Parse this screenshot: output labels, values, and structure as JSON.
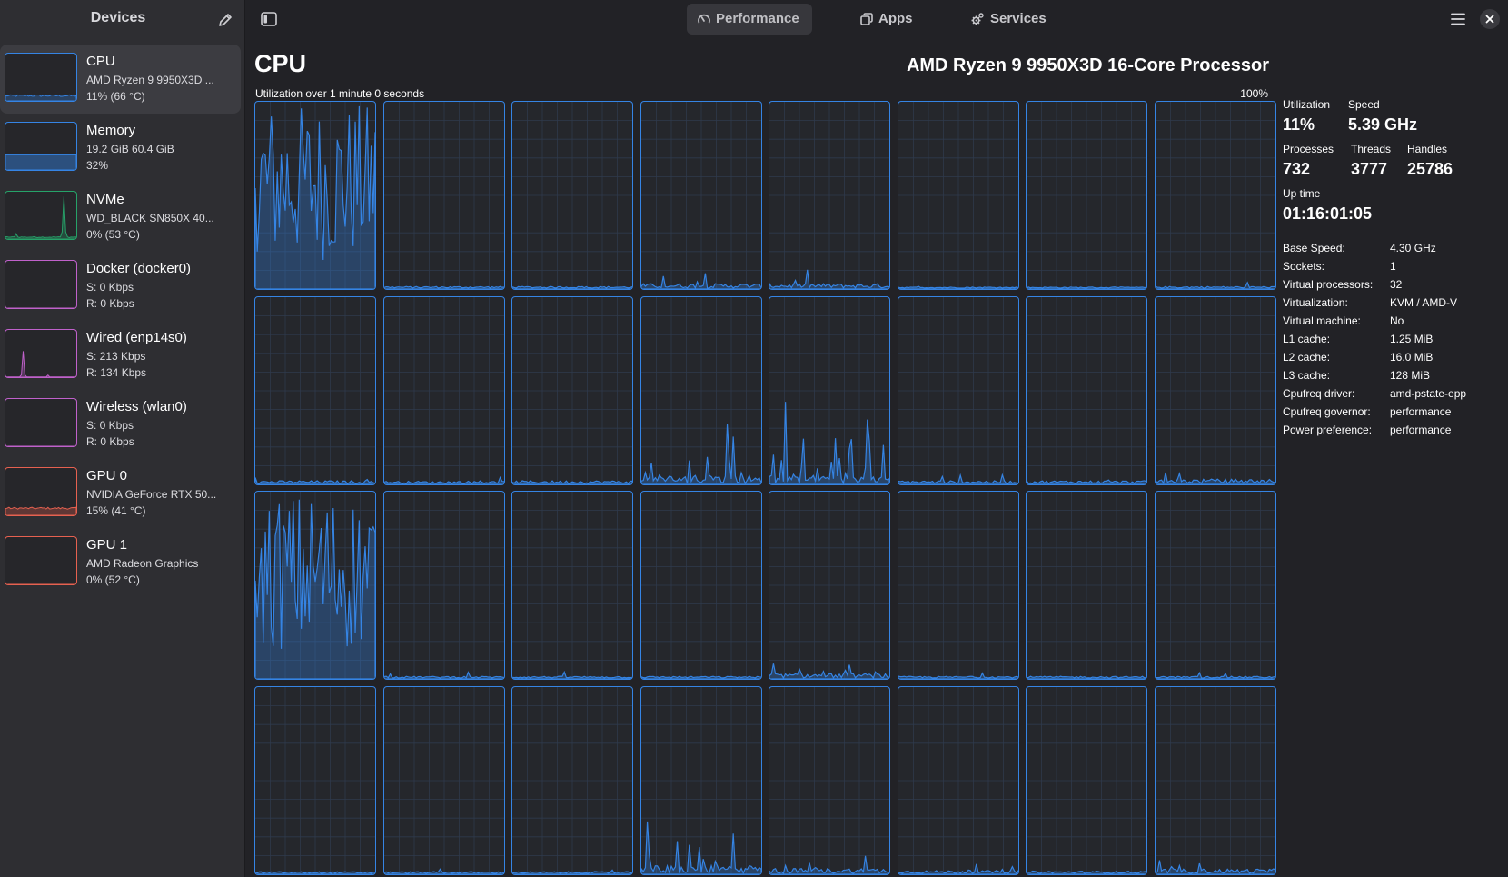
{
  "sidebar": {
    "title": "Devices",
    "edit_icon": "pencil-icon",
    "devices": [
      {
        "name": "CPU",
        "line1": "AMD Ryzen 9 9950X3D ...",
        "line2": "11% (66 °C)",
        "color": "#3584e4",
        "fill_percent": 11,
        "selected": true
      },
      {
        "name": "Memory",
        "line1": "19.2 GiB 60.4 GiB",
        "line2": "32%",
        "color": "#3584e4",
        "fill_percent": 32
      },
      {
        "name": "NVMe",
        "line1": "WD_BLACK SN850X 40...",
        "line2": "0% (53 °C)",
        "color": "#26a269"
      },
      {
        "name": "Docker (docker0)",
        "line1": "S: 0 Kbps",
        "line2": "R: 0 Kbps",
        "color": "#c061cb"
      },
      {
        "name": "Wired (enp14s0)",
        "line1": "S: 213 Kbps",
        "line2": "R: 134 Kbps",
        "color": "#c061cb"
      },
      {
        "name": "Wireless (wlan0)",
        "line1": "S: 0 Kbps",
        "line2": "R: 0 Kbps",
        "color": "#c061cb"
      },
      {
        "name": "GPU 0",
        "line1": "NVIDIA GeForce RTX 50...",
        "line2": "15% (41 °C)",
        "color": "#e66150",
        "fill_percent": 15
      },
      {
        "name": "GPU 1",
        "line1": "AMD Radeon Graphics",
        "line2": "0% (52 °C)",
        "color": "#e66150",
        "fill_percent": 0
      }
    ]
  },
  "header": {
    "sidebar_toggle_icon": "sidebar-toggle-icon",
    "tabs": [
      {
        "label": "Performance",
        "icon": "speedometer-icon",
        "active": true
      },
      {
        "label": "Apps",
        "icon": "apps-icon"
      },
      {
        "label": "Services",
        "icon": "gears-icon"
      }
    ],
    "menu_icon": "hamburger-menu-icon",
    "close_icon": "close-icon"
  },
  "main": {
    "title": "CPU",
    "model": "AMD Ryzen 9 9950X3D 16-Core Processor",
    "graph_caption": "Utilization over 1 minute 0 seconds",
    "graph_max": "100%",
    "graph_color": "#3584e4",
    "core_count": 32,
    "core_activity": [
      3,
      0.3,
      0.3,
      0.8,
      0.8,
      0.2,
      0.2,
      0.3,
      0.5,
      0.4,
      0.5,
      1.5,
      1.5,
      0.5,
      0.5,
      0.8,
      3,
      0.3,
      0.3,
      0.3,
      0.8,
      0.3,
      0.3,
      0.3,
      0.3,
      0.3,
      0.3,
      1.4,
      0.9,
      0.5,
      0.4,
      0.8
    ]
  },
  "stats": {
    "utilization_label": "Utilization",
    "utilization": "11%",
    "speed_label": "Speed",
    "speed": "5.39 GHz",
    "processes_label": "Processes",
    "processes": "732",
    "threads_label": "Threads",
    "threads": "3777",
    "handles_label": "Handles",
    "handles": "25786",
    "uptime_label": "Up time",
    "uptime": "01:16:01:05",
    "info": [
      {
        "k": "Base Speed:",
        "v": "4.30 GHz"
      },
      {
        "k": "Sockets:",
        "v": "1"
      },
      {
        "k": "Virtual processors:",
        "v": "32"
      },
      {
        "k": "Virtualization:",
        "v": "KVM / AMD-V"
      },
      {
        "k": "Virtual machine:",
        "v": "No"
      },
      {
        "k": "L1 cache:",
        "v": "1.25 MiB"
      },
      {
        "k": "L2 cache:",
        "v": "16.0 MiB"
      },
      {
        "k": "L3 cache:",
        "v": "128 MiB"
      },
      {
        "k": "Cpufreq driver:",
        "v": "amd-pstate-epp"
      },
      {
        "k": "Cpufreq governor:",
        "v": "performance"
      },
      {
        "k": "Power preference:",
        "v": "performance"
      }
    ]
  }
}
